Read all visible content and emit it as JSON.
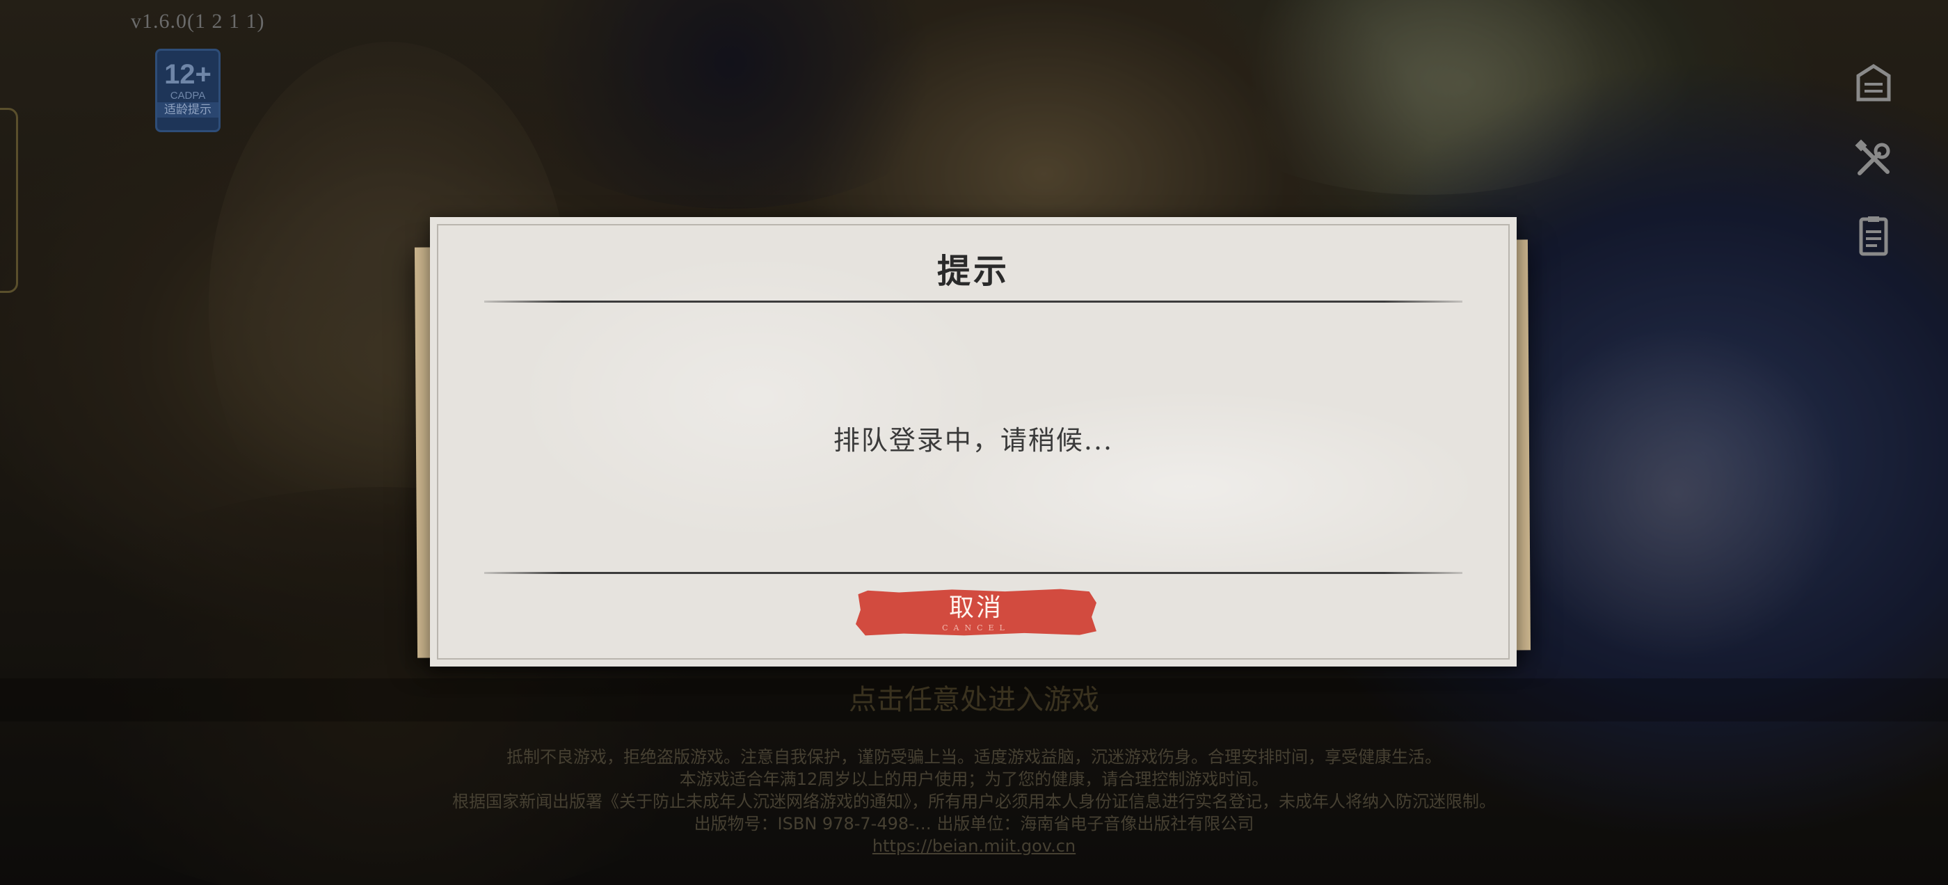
{
  "version": "v1.6.0(1 2 1 1)",
  "age_badge": {
    "age": "12+",
    "org": "CADPA",
    "tip": "适龄提示"
  },
  "side_icons": [
    "announcement-icon",
    "repair-tools-icon",
    "clipboard-icon"
  ],
  "enter_prompt": "点击任意处进入游戏",
  "footer_lines": [
    "抵制不良游戏，拒绝盗版游戏。注意自我保护，谨防受骗上当。适度游戏益脑，沉迷游戏伤身。合理安排时间，享受健康生活。",
    "本游戏适合年满12周岁以上的用户使用；为了您的健康，请合理控制游戏时间。",
    "根据国家新闻出版署《关于防止未成年人沉迷网络游戏的通知》，所有用户必须用本人身份证信息进行实名登记，未成年人将纳入防沉迷限制。",
    "出版物号：ISBN 978-7-498-…  出版单位：海南省电子音像出版社有限公司",
    "https://beian.miit.gov.cn"
  ],
  "dialog": {
    "title": "提示",
    "message": "排队登录中，请稍候...",
    "cancel_label": "取消",
    "cancel_sub": "CANCEL"
  },
  "colors": {
    "button_red": "#d24b3f",
    "dialog_paper": "#e6e3de",
    "badge_blue": "#1e3558"
  }
}
